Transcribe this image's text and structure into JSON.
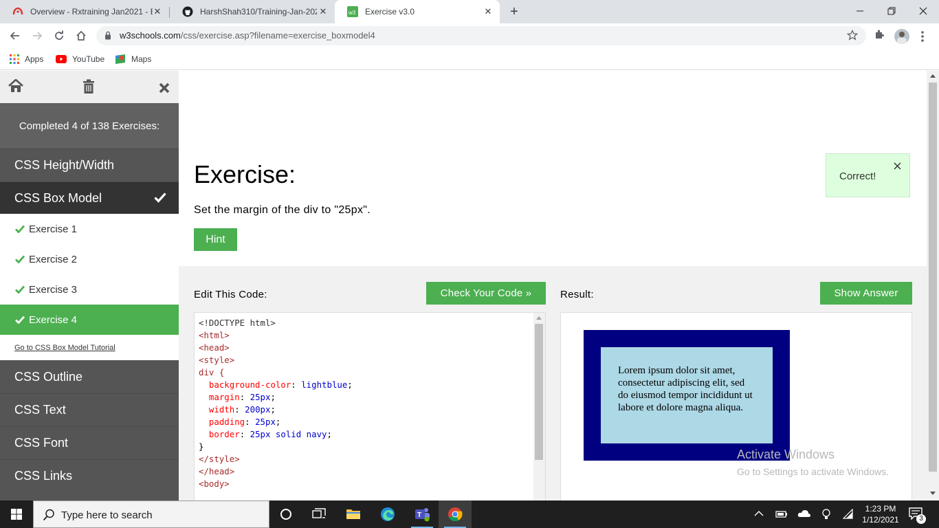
{
  "browser": {
    "tabs": [
      {
        "title": "Overview - Rxtraining Jan2021 - E",
        "active": false
      },
      {
        "title": "HarshShah310/Training-Jan-2021",
        "active": false
      },
      {
        "title": "Exercise v3.0",
        "active": true
      }
    ],
    "url_host": "w3schools.com",
    "url_path": "/css/exercise.asp?filename=exercise_boxmodel4",
    "bookmarks": [
      "Apps",
      "YouTube",
      "Maps"
    ]
  },
  "sidebar": {
    "progress_text": "Completed 4 of 138 Exercises:",
    "items_before": [
      "CSS Height/Width"
    ],
    "selected_item": "CSS Box Model",
    "exercises": [
      "Exercise 1",
      "Exercise 2",
      "Exercise 3",
      "Exercise 4"
    ],
    "tutorial_link": "Go to CSS Box Model Tutorial",
    "items_after": [
      "CSS Outline",
      "CSS Text",
      "CSS Font",
      "CSS Links"
    ]
  },
  "exercise": {
    "title": "Exercise:",
    "description": "Set the margin of the div to \"25px\".",
    "hint_label": "Hint",
    "status_message": "Correct!"
  },
  "editor": {
    "label": "Edit This Code:",
    "check_button": "Check Your Code »",
    "code": {
      "doctype": "<!DOCTYPE html>",
      "html_open": "<html>",
      "head_open": "<head>",
      "style_open": "<style>",
      "selector": "div {",
      "decl1_prop": "background-color",
      "decl1_val": "lightblue",
      "decl2_prop": "margin",
      "decl2_val": "25px",
      "decl3_prop": "width",
      "decl3_val": "200px",
      "decl4_prop": "padding",
      "decl4_val": "25px",
      "decl5_prop": "border",
      "decl5_val": "25px solid navy",
      "close_brace": "}",
      "style_close": "</style>",
      "head_close": "</head>",
      "body_open": "<body>"
    }
  },
  "result": {
    "label": "Result:",
    "show_answer_button": "Show Answer",
    "demo_text": "Lorem ipsum dolor sit amet, consectetur adipiscing elit, sed do eiusmod tempor incididunt ut labore et dolore magna aliqua."
  },
  "watermark": {
    "line1": "Activate Windows",
    "line2": "Go to Settings to activate Windows."
  },
  "taskbar": {
    "search_placeholder": "Type here to search",
    "time": "1:23 PM",
    "date": "1/12/2021",
    "notification_count": "3"
  },
  "colors": {
    "accent_green": "#4caf50",
    "sidebar_dark": "#555555",
    "selected_dark": "#333333",
    "correct_bg": "#ddffdd"
  }
}
